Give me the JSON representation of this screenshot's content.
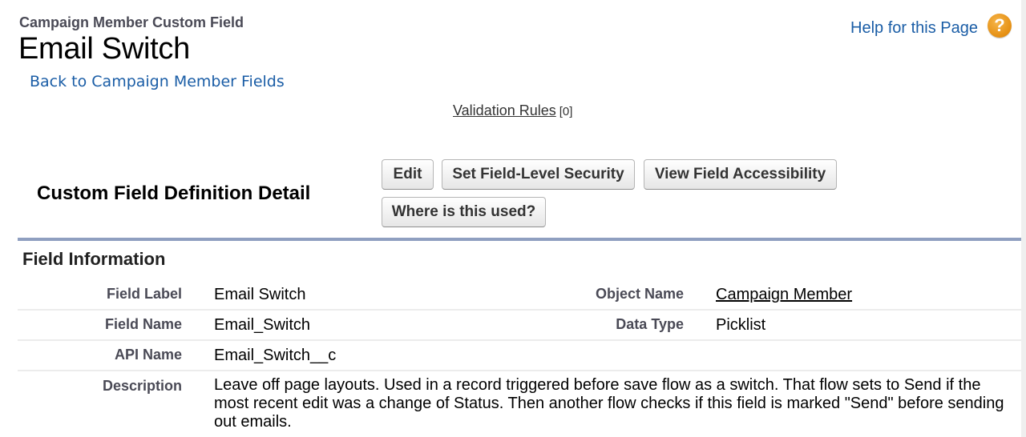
{
  "header": {
    "subtitle": "Campaign Member Custom Field",
    "title": "Email Switch",
    "back_link": "Back to Campaign Member Fields",
    "help_link": "Help for this Page",
    "help_icon": "?"
  },
  "related": {
    "validation_rules_label": "Validation Rules",
    "validation_rules_count": "[0]"
  },
  "detail": {
    "section_title": "Custom Field Definition Detail",
    "buttons": {
      "edit": "Edit",
      "set_fls": "Set Field-Level Security",
      "view_access": "View Field Accessibility",
      "where_used": "Where is this used?"
    }
  },
  "field_information": {
    "title": "Field Information",
    "rows": [
      {
        "label": "Field Label",
        "value": "Email Switch",
        "label2": "Object Name",
        "value2": "Campaign Member"
      },
      {
        "label": "Field Name",
        "value": "Email_Switch",
        "label2": "Data Type",
        "value2": "Picklist"
      },
      {
        "label": "API Name",
        "value": "Email_Switch__c"
      },
      {
        "label": "Description",
        "value": "Leave off page layouts. Used in a record triggered before save flow as a switch. That flow sets to Send if the most recent edit was a change of Status. Then another flow checks if this field is marked \"Send\" before sending out emails."
      }
    ]
  },
  "colors": {
    "link": "#1a5da6",
    "separator": "#8f9fc0",
    "label": "#4a4a56",
    "help_icon": "#e58f12"
  }
}
